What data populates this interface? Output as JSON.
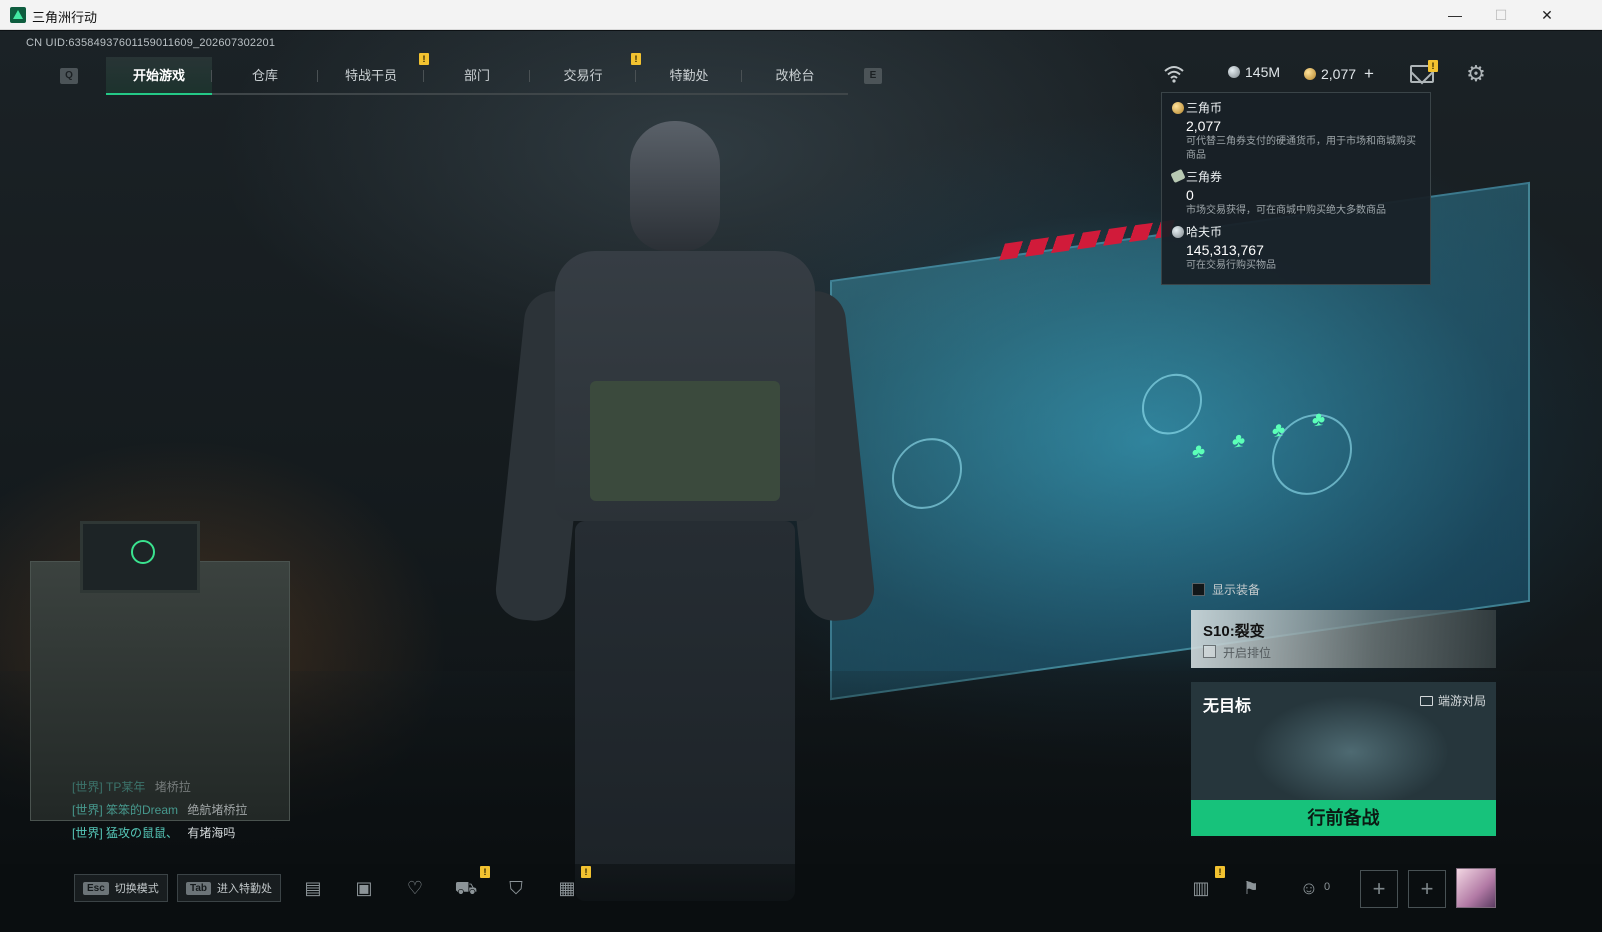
{
  "window": {
    "title": "三角洲行动",
    "minimize": "—",
    "maximize": "☐",
    "close": "✕"
  },
  "uid": "CN UID:6358493760115901160​9_202607302201",
  "nav": {
    "left_key": "Q",
    "right_key": "E",
    "tabs": [
      {
        "label": "开始游戏",
        "active": true
      },
      {
        "label": "仓库"
      },
      {
        "label": "特战干员"
      },
      {
        "label": "部门",
        "badge": "!"
      },
      {
        "label": "交易行"
      },
      {
        "label": "特勤处",
        "badge": "!"
      },
      {
        "label": "改枪台"
      }
    ]
  },
  "topbar": {
    "wifi_icon": "wifi-icon",
    "hafu_short": "145M",
    "sanjiao_short": "2,077",
    "plus": "+",
    "mail_badge": "!",
    "mail_icon": "mail-icon",
    "settings_icon": "gear-icon"
  },
  "currency_popover": [
    {
      "name": "三角币",
      "value": "2,077",
      "desc": "可代替三角券支付的硬通货币，用于市场和商城购买商品",
      "icon": "gold-coin"
    },
    {
      "name": "三角券",
      "value": "0",
      "desc": "市场交易获得，可在商城中购买绝大多数商品",
      "icon": "ticket"
    },
    {
      "name": "哈夫币",
      "value": "145,313,767",
      "desc": "可在交易行购买物品",
      "icon": "silver-coin"
    }
  ],
  "right_panel": {
    "show_equipment": "显示装备",
    "season_title": "S10:裂变",
    "season_sub": "开启排位",
    "map_title": "无目标",
    "map_mode": "端游对局",
    "start_button": "行前备战"
  },
  "chat": [
    {
      "channel": "[世界]",
      "name": "TP某年",
      "msg": "堵桥拉"
    },
    {
      "channel": "[世界]",
      "name": "笨笨的Dream",
      "msg": "绝航堵桥拉"
    },
    {
      "channel": "[世界]",
      "name": "猛攻の鼠鼠、",
      "msg": "有堵海吗"
    }
  ],
  "bottom": {
    "esc_key": "Esc",
    "esc_label": "切换模式",
    "tab_key": "Tab",
    "tab_label": "进入特勤处",
    "friends_count": "0",
    "plus": "+",
    "icons": [
      "chat-icon",
      "gift-icon",
      "shield-heart-icon",
      "shop-icon",
      "badge-icon",
      "calendar-icon"
    ],
    "right_icons": [
      "stats-icon",
      "flag-icon",
      "friends-icon"
    ]
  },
  "colors": {
    "accent_green": "#17c27b",
    "badge_yellow": "#f2c230",
    "chat_teal": "#56c8b9"
  }
}
